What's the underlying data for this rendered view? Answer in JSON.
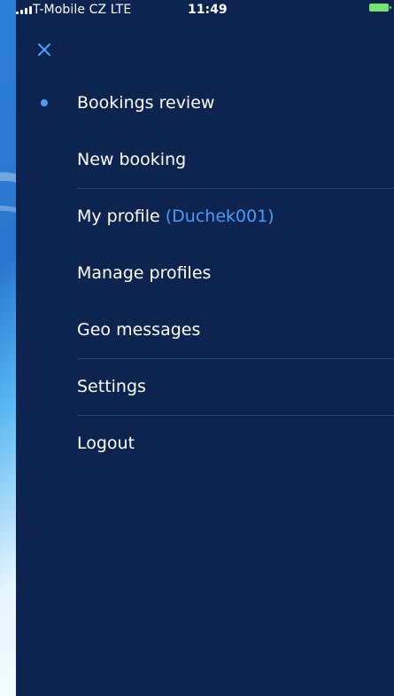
{
  "status_bar": {
    "carrier": "T-Mobile CZ  LTE",
    "time": "11:49"
  },
  "menu": {
    "items": [
      {
        "label": "Bookings review",
        "active": true
      },
      {
        "label": "New booking"
      },
      {
        "label": "My profile",
        "username": "(Duchek001)"
      },
      {
        "label": "Manage profiles"
      },
      {
        "label": "Geo messages"
      },
      {
        "label": "Settings"
      },
      {
        "label": "Logout"
      }
    ]
  },
  "icons": {
    "close": "close-icon",
    "signal": "signal-icon",
    "battery": "battery-icon",
    "active_bullet": "active-dot-icon"
  },
  "colors": {
    "drawer_background": "#0d2450",
    "accent": "#4a9cf5",
    "battery": "#73e46f"
  }
}
